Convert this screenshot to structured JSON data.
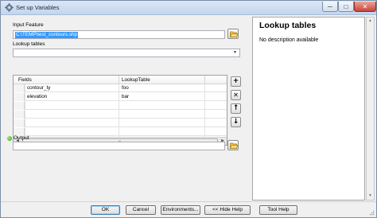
{
  "window": {
    "title": "Set up Variables",
    "minimize_glyph": "─",
    "maximize_glyph": "□",
    "close_glyph": "✕"
  },
  "form": {
    "input_feature_label": "Input Feature",
    "input_feature_value": "C:\\TEMP\\test_contours.shp",
    "lookup_tables_label": "Lookup tables",
    "lookup_tables_value": "",
    "output_label": "Output",
    "output_value": ""
  },
  "table": {
    "columns": [
      "Fields",
      "LookupTable"
    ],
    "rows": [
      {
        "field": "contour_ty",
        "lookup": "foo"
      },
      {
        "field": "elevation",
        "lookup": "bar"
      },
      {
        "field": "",
        "lookup": ""
      },
      {
        "field": "",
        "lookup": ""
      },
      {
        "field": "",
        "lookup": ""
      },
      {
        "field": "",
        "lookup": ""
      }
    ],
    "scroll_left_glyph": "◀",
    "scroll_right_glyph": "▶",
    "scroll_grip_glyph": "|||"
  },
  "side_buttons": {
    "add": "+",
    "remove": "✕",
    "up": "↑",
    "down": "↓"
  },
  "help": {
    "title": "Lookup tables",
    "description": "No description available",
    "scroll_up_glyph": "▲",
    "scroll_down_glyph": "▼"
  },
  "buttons": {
    "ok": "OK",
    "cancel": "Cancel",
    "environments": "Environments...",
    "hide_help": "<< Hide Help",
    "tool_help": "Tool Help"
  },
  "combo_arrow_glyph": "▼",
  "colors": {
    "selection": "#3399ff",
    "title_bar": "#c3d6ee",
    "close_button": "#c7443a",
    "output_indicator": "#2f9a1c"
  }
}
